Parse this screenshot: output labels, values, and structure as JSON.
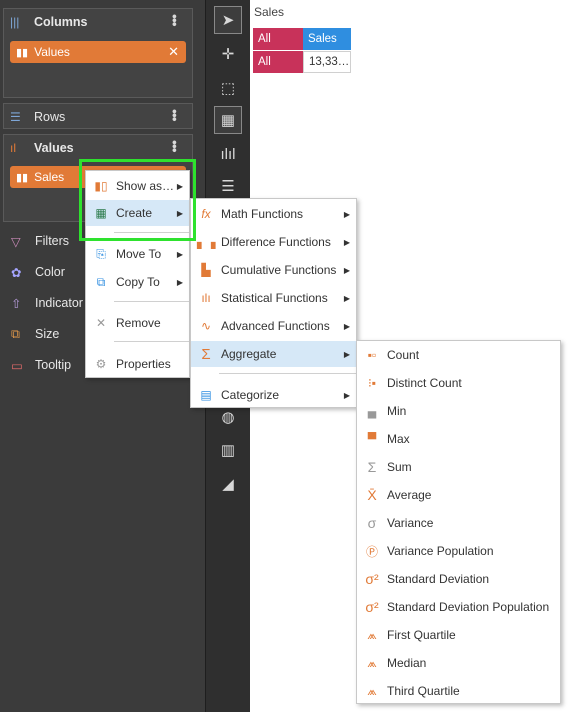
{
  "left_panel": {
    "columns": {
      "label": "Columns",
      "pill": "Values"
    },
    "rows": {
      "label": "Rows"
    },
    "values": {
      "label": "Values",
      "pill": "Sales"
    },
    "filters": "Filters",
    "color": "Color",
    "indicator": "Indicator",
    "size": "Size",
    "tooltip": "Tooltip"
  },
  "table": {
    "title": "Sales",
    "header": [
      "All",
      "Sales"
    ],
    "row": [
      "All",
      "13,33…"
    ]
  },
  "context_menu": {
    "items": [
      "Show as…",
      "Create",
      "Move To",
      "Copy To",
      "Remove",
      "Properties"
    ]
  },
  "create_menu": {
    "items": [
      "Math Functions",
      "Difference Functions",
      "Cumulative Functions",
      "Statistical Functions",
      "Advanced Functions",
      "Aggregate",
      "Categorize"
    ]
  },
  "aggregate_menu": {
    "items": [
      "Count",
      "Distinct Count",
      "Min",
      "Max",
      "Sum",
      "Average",
      "Variance",
      "Variance Population",
      "Standard Deviation",
      "Standard Deviation Population",
      "First Quartile",
      "Median",
      "Third Quartile"
    ]
  },
  "colors": {
    "accent_orange": "#e17a37",
    "highlight_green": "#2ee22e",
    "header_blue": "#2f8ee0",
    "all_magenta": "#c8325a"
  }
}
